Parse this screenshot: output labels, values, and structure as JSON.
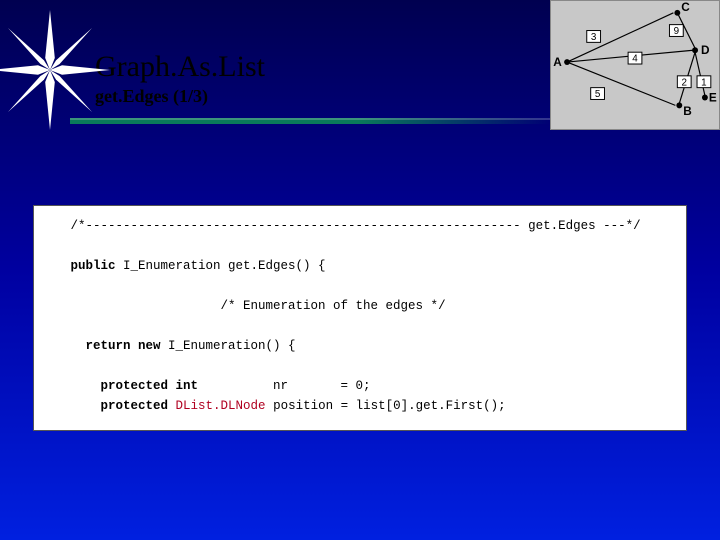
{
  "header": {
    "title": "Graph.As.List",
    "subtitle": "get.Edges   (1/3)"
  },
  "graph": {
    "nodes": [
      "A",
      "B",
      "C",
      "D",
      "E"
    ],
    "edge_weights": [
      "3",
      "9",
      "4",
      "2",
      "1",
      "5"
    ]
  },
  "code": {
    "l1_a": "   /*---------------------------------------------------------- get.Edges ---*/",
    "l2_kw1": "   public",
    "l2_mid": " I_Enumeration get.Edges() {",
    "l3": "                       /* Enumeration of the edges */",
    "l4_kw": "     return new",
    "l4_rest": " I_Enumeration() {",
    "l5_kw": "       protected int",
    "l5_rest": "          nr       = 0;",
    "l6_kw": "       protected",
    "l6_type": " DList.DLNode",
    "l6_rest": " position = list[0].get.First();"
  }
}
